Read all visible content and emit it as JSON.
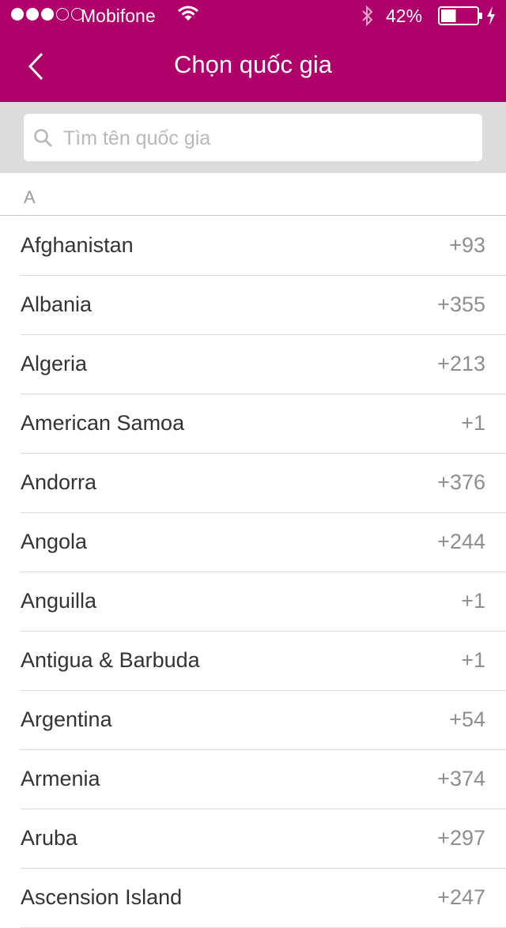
{
  "status_bar": {
    "carrier": "Mobifone",
    "battery_percent": "42%",
    "battery_level": 0.42
  },
  "nav": {
    "title": "Chọn quốc gia"
  },
  "search": {
    "placeholder": "Tìm tên quốc gia",
    "value": ""
  },
  "section": {
    "letter": "A"
  },
  "countries": [
    {
      "name": "Afghanistan",
      "code": "+93"
    },
    {
      "name": "Albania",
      "code": "+355"
    },
    {
      "name": "Algeria",
      "code": "+213"
    },
    {
      "name": "American Samoa",
      "code": "+1"
    },
    {
      "name": "Andorra",
      "code": "+376"
    },
    {
      "name": "Angola",
      "code": "+244"
    },
    {
      "name": "Anguilla",
      "code": "+1"
    },
    {
      "name": "Antigua & Barbuda",
      "code": "+1"
    },
    {
      "name": "Argentina",
      "code": "+54"
    },
    {
      "name": "Armenia",
      "code": "+374"
    },
    {
      "name": "Aruba",
      "code": "+297"
    },
    {
      "name": "Ascension Island",
      "code": "+247"
    }
  ],
  "colors": {
    "header": "#b0006a",
    "search_bg": "#dcdcdc"
  }
}
